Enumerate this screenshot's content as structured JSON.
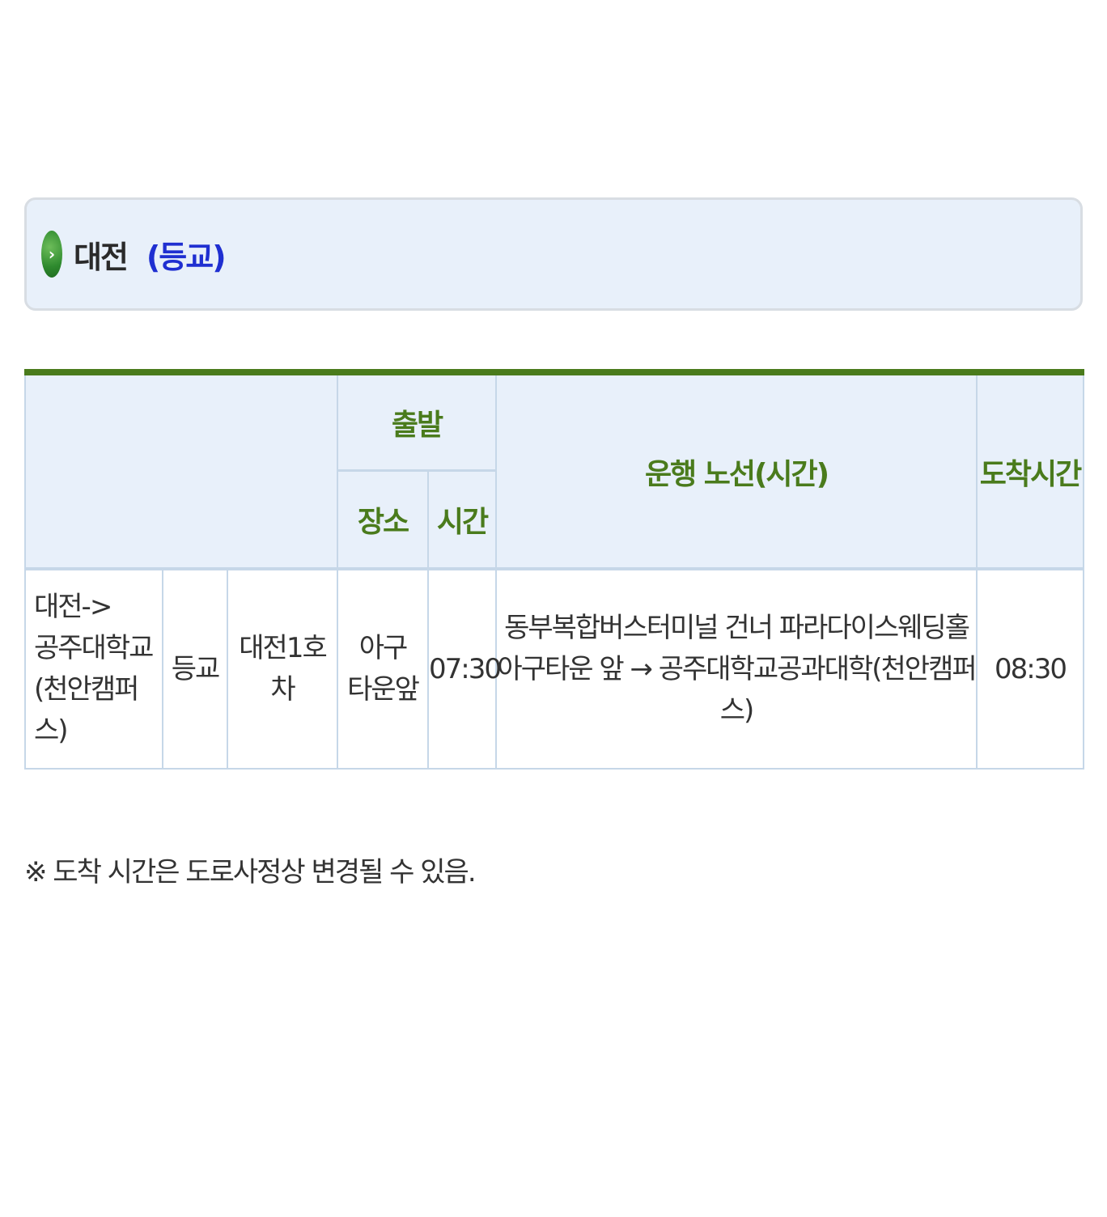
{
  "header": {
    "region": "대전",
    "direction": "(등교)"
  },
  "table": {
    "headers": {
      "departure": "출발",
      "place": "장소",
      "time": "시간",
      "route": "운행 노선(시간)",
      "arrival": "도착시간"
    },
    "rows": [
      {
        "route_name_line1": "대전->",
        "route_name_line2": "공주대학교",
        "route_name_line3": "(천안캠퍼스)",
        "type": "등교",
        "bus": "대전1호차",
        "place_line1": "아구",
        "place_line2": "타운앞",
        "depart_time": "07:30",
        "route_line1": "동부복합버스터미널 건너 파라다이스웨딩홀",
        "route_line2": "아구타운 앞 → 공주대학교공과대학(천안캠퍼스)",
        "arrival_time": "08:30"
      }
    ]
  },
  "footnote": "※ 도착 시간은 도로사정상 변경될 수 있음."
}
